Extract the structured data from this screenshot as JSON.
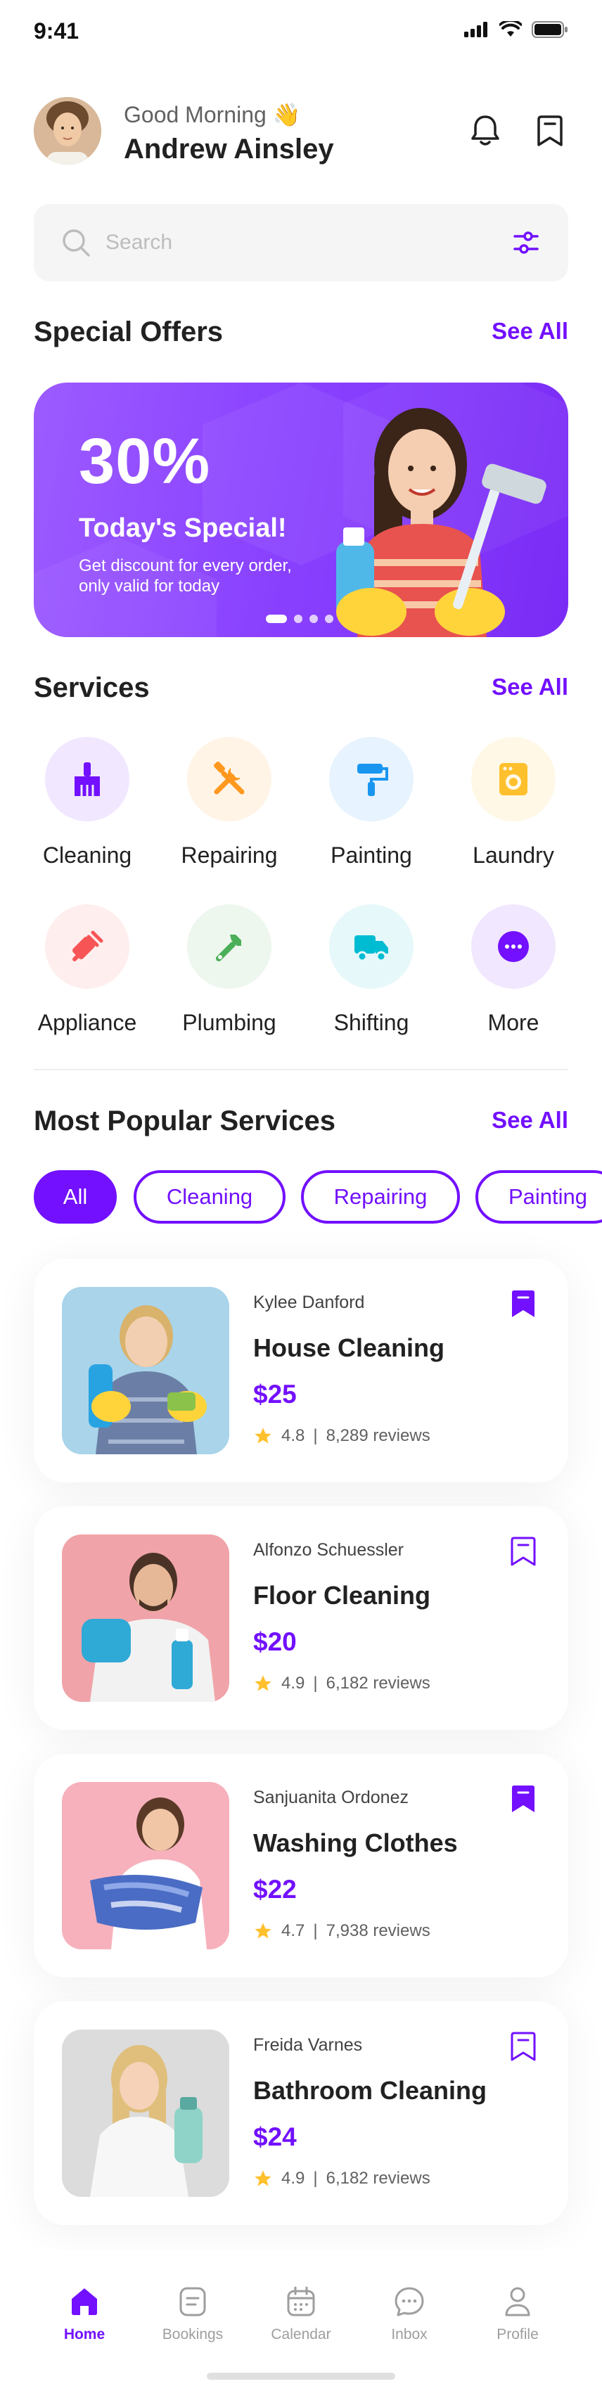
{
  "status": {
    "time": "9:41"
  },
  "header": {
    "greeting": "Good Morning 👋",
    "user_name": "Andrew Ainsley"
  },
  "search": {
    "placeholder": "Search"
  },
  "special_offers": {
    "title": "Special Offers",
    "see_all": "See All",
    "banner": {
      "percent": "30%",
      "title": "Today's Special!",
      "text": "Get discount for every order, only valid for today"
    }
  },
  "services": {
    "title": "Services",
    "see_all": "See All",
    "items": [
      {
        "label": "Cleaning",
        "icon": "broom-icon",
        "color": "#7210ff",
        "bg": "#f1e7ff"
      },
      {
        "label": "Repairing",
        "icon": "tools-icon",
        "color": "#ff981f",
        "bg": "#fff4e6"
      },
      {
        "label": "Painting",
        "icon": "paint-roller-icon",
        "color": "#1a96f0",
        "bg": "#e7f3fe"
      },
      {
        "label": "Laundry",
        "icon": "washing-machine-icon",
        "color": "#ffc02d",
        "bg": "#fff8e6"
      },
      {
        "label": "Appliance",
        "icon": "appliance-icon",
        "color": "#f75555",
        "bg": "#ffeeee"
      },
      {
        "label": "Plumbing",
        "icon": "wrench-icon",
        "color": "#4aaf57",
        "bg": "#edf7ee"
      },
      {
        "label": "Shifting",
        "icon": "truck-icon",
        "color": "#00bcd3",
        "bg": "#e6f8fa"
      },
      {
        "label": "More",
        "icon": "more-icon",
        "color": "#7210ff",
        "bg": "#f1e7ff"
      }
    ]
  },
  "popular": {
    "title": "Most Popular Services",
    "see_all": "See All",
    "chips": [
      "All",
      "Cleaning",
      "Repairing",
      "Painting"
    ],
    "active_chip": "All",
    "cards": [
      {
        "provider": "Kylee Danford",
        "title": "House Cleaning",
        "price": "$25",
        "rating": "4.8",
        "reviews": "8,289 reviews",
        "bookmarked": true,
        "img_bg": "#a9d4ea"
      },
      {
        "provider": "Alfonzo Schuessler",
        "title": "Floor Cleaning",
        "price": "$20",
        "rating": "4.9",
        "reviews": "6,182 reviews",
        "bookmarked": false,
        "img_bg": "#f0a3a8"
      },
      {
        "provider": "Sanjuanita Ordonez",
        "title": "Washing Clothes",
        "price": "$22",
        "rating": "4.7",
        "reviews": "7,938 reviews",
        "bookmarked": true,
        "img_bg": "#f7b1bd"
      },
      {
        "provider": "Freida Varnes",
        "title": "Bathroom Cleaning",
        "price": "$24",
        "rating": "4.9",
        "reviews": "6,182 reviews",
        "bookmarked": false,
        "img_bg": "#dcdcdc"
      }
    ]
  },
  "nav": {
    "active": "Home",
    "items": [
      {
        "label": "Home",
        "icon": "home-icon"
      },
      {
        "label": "Bookings",
        "icon": "document-icon"
      },
      {
        "label": "Calendar",
        "icon": "calendar-icon"
      },
      {
        "label": "Inbox",
        "icon": "chat-icon"
      },
      {
        "label": "Profile",
        "icon": "profile-icon"
      }
    ]
  },
  "colors": {
    "primary": "#7210ff",
    "text": "#212121",
    "muted": "#9e9e9e",
    "star": "#ffc02d"
  }
}
